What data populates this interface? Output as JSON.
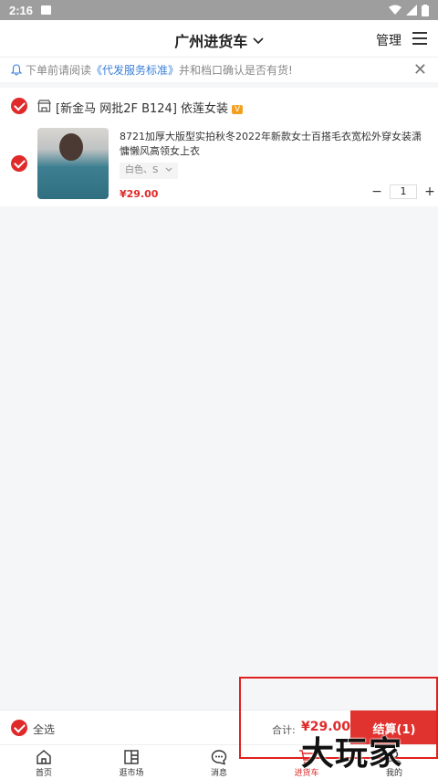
{
  "status": {
    "time": "2:16"
  },
  "header": {
    "title": "广州进货车",
    "manage_label": "管理"
  },
  "notice": {
    "prefix": "下单前请阅读",
    "link": "《代发服务标准》",
    "suffix": "并和档口确认是否有货!"
  },
  "shop": {
    "name": "[新金马 网批2F B124] 依莲女装",
    "badge": "V",
    "item": {
      "title": "8721加厚大版型实拍秋冬2022年新款女士百搭毛衣宽松外穿女装潇慵懒风高领女上衣",
      "spec": "白色、S",
      "price": "¥29.00",
      "quantity": "1"
    }
  },
  "bottom": {
    "select_all": "全选",
    "total_label": "合计:",
    "total": "¥29.00",
    "checkout": "结算(1)"
  },
  "tabs": [
    {
      "label": "首页",
      "icon": "home-icon"
    },
    {
      "label": "逛市场",
      "icon": "market-icon"
    },
    {
      "label": "消息",
      "icon": "message-icon"
    },
    {
      "label": "进货车",
      "icon": "cart-icon"
    },
    {
      "label": "我的",
      "icon": "profile-icon"
    }
  ],
  "watermark": "大玩家",
  "colors": {
    "accent": "#e02a2a",
    "link": "#3b7fd9",
    "badge": "#f3a021"
  }
}
